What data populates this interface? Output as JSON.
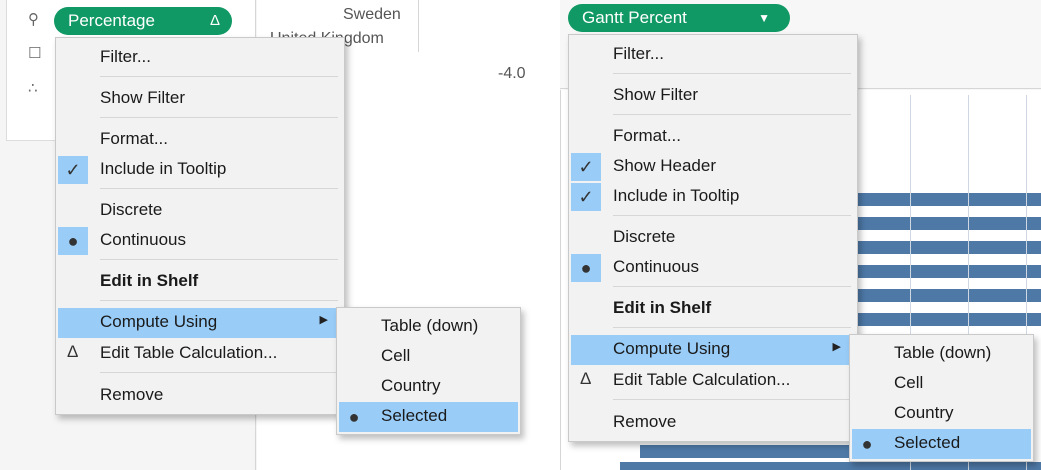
{
  "left": {
    "pill": {
      "label": "Percentage",
      "symbol": "Δ"
    },
    "view_rows": [
      "Sweden",
      "United Kingdom"
    ],
    "axis_tick": "-4.0",
    "context_menu": {
      "items": [
        "Filter...",
        "Show Filter",
        "Format...",
        "Include in Tooltip",
        "Discrete",
        "Continuous",
        "Edit in Shelf",
        "Compute Using",
        "Edit Table Calculation...",
        "Remove"
      ]
    },
    "submenu": {
      "items": [
        "Table (down)",
        "Cell",
        "Country",
        "Selected"
      ]
    }
  },
  "right": {
    "pill": {
      "label": "Gantt Percent"
    },
    "context_menu": {
      "items": [
        "Filter...",
        "Show Filter",
        "Format...",
        "Show Header",
        "Include in Tooltip",
        "Discrete",
        "Continuous",
        "Edit in Shelf",
        "Compute Using",
        "Edit Table Calculation...",
        "Remove"
      ]
    },
    "submenu": {
      "items": [
        "Table (down)",
        "Cell",
        "Country",
        "Selected"
      ]
    }
  },
  "colors": {
    "pill_green": "#109965",
    "menu_bg": "#f2f2f2",
    "highlight_blue": "#99cdf8",
    "bar_blue": "#4e79a7"
  }
}
